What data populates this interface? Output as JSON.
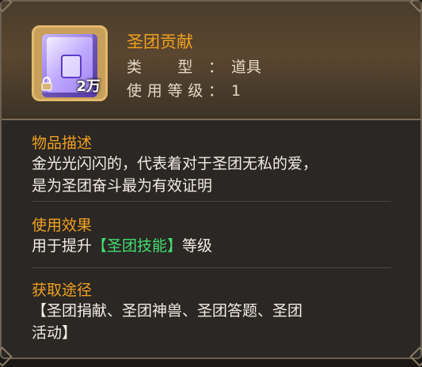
{
  "item": {
    "name": "圣团贡献",
    "quantity": "2万",
    "type_label": "类 型：",
    "type_value": "道具",
    "level_label": "使用等级：",
    "level_value": "1",
    "icon": "purple-book-icon",
    "lock_icon": "lock-icon"
  },
  "sections": {
    "description": {
      "title": "物品描述",
      "line1": "金光光闪闪的，代表着对于圣团无私的爱，",
      "line2": "是为圣团奋斗最为有效证明"
    },
    "effect": {
      "title": "使用效果",
      "prefix": "用于提升",
      "highlight": "【圣团技能】",
      "suffix": "等级"
    },
    "source": {
      "title": "获取途径",
      "line1": "【圣团捐献、圣团神兽、圣团答题、圣团",
      "line2": "活动】"
    }
  },
  "colors": {
    "title": "#f0a020",
    "highlight": "#43dd71",
    "text": "#f2ece3"
  }
}
